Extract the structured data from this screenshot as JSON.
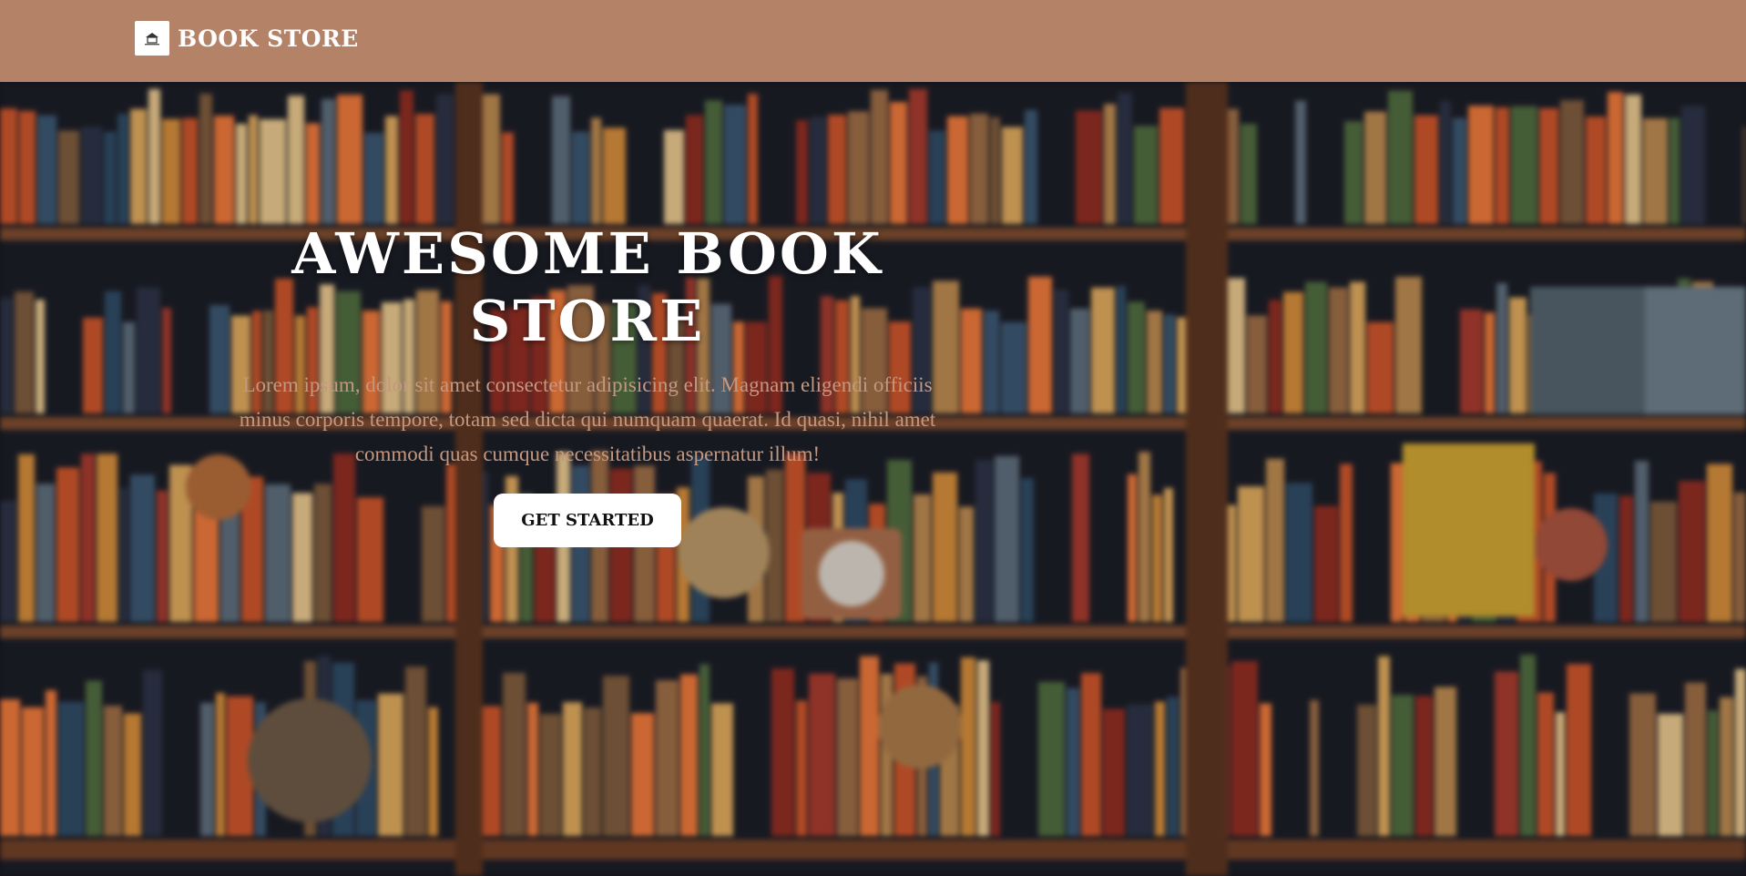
{
  "navbar": {
    "brand": "BOOK STORE",
    "logo_icon": "book-store-logo-icon"
  },
  "hero": {
    "title": "AWESOME BOOK STORE",
    "description": "Lorem ipsum, dolor sit amet consectetur adipisicing elit. Magnam eligendi officiis minus corporis tempore, totam sed dicta qui numquam quaerat. Id quasi, nihil amet commodi quas cumque necessitatibus aspernatur illum!",
    "cta_label": "GET STARTED",
    "background": "blurred-bookshelf-photo"
  },
  "colors": {
    "navbar_bg": "#b38267",
    "hero_text": "#c49880",
    "title_text": "#ffffff",
    "cta_bg": "#ffffff"
  }
}
